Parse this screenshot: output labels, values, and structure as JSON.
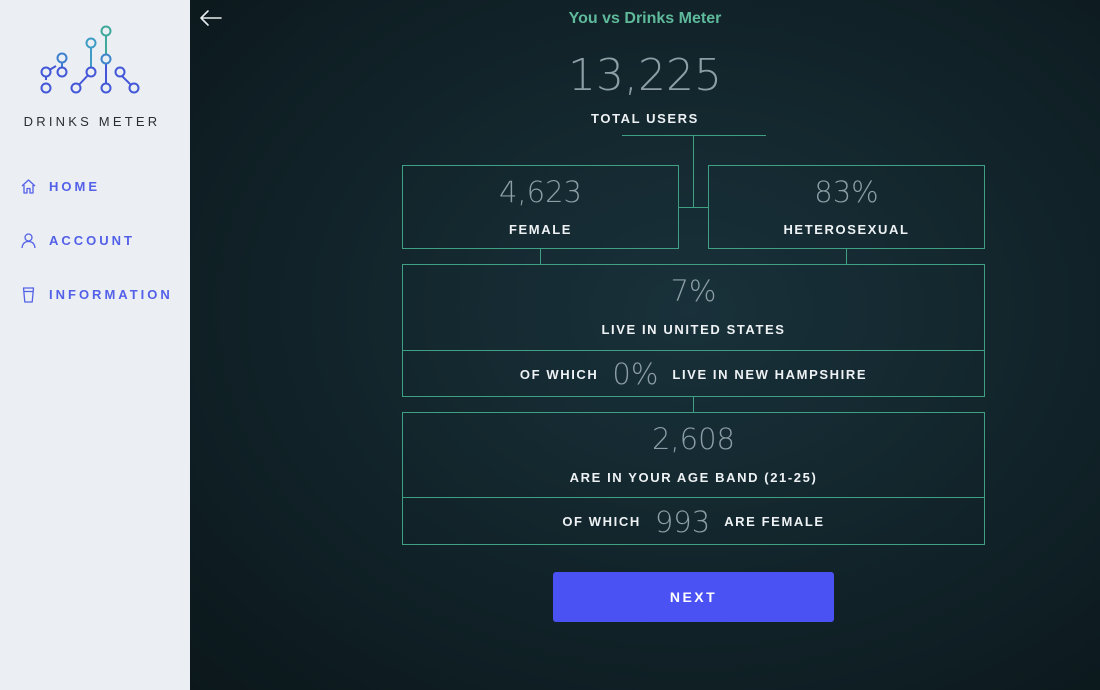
{
  "app": {
    "logo_text": "DRINKS METER"
  },
  "sidebar": {
    "items": [
      {
        "label": "HOME",
        "icon": "home-icon"
      },
      {
        "label": "ACCOUNT",
        "icon": "user-icon"
      },
      {
        "label": "INFORMATION",
        "icon": "cup-icon"
      }
    ]
  },
  "header": {
    "title": "You vs Drinks Meter",
    "back_icon": "arrow-left-icon"
  },
  "stats": {
    "total": {
      "value": "13,225",
      "label": "TOTAL USERS"
    },
    "female": {
      "value": "4,623",
      "label": "FEMALE"
    },
    "hetero": {
      "value": "83%",
      "label": "HETEROSEXUAL"
    },
    "country": {
      "value": "7%",
      "label": "LIVE IN UNITED STATES"
    },
    "state": {
      "prefix": "OF WHICH",
      "value": "0%",
      "suffix": "LIVE IN NEW HAMPSHIRE"
    },
    "age": {
      "value": "2,608",
      "label": "ARE IN YOUR AGE BAND (21-25)"
    },
    "age_female": {
      "prefix": "OF WHICH",
      "value": "993",
      "suffix": "ARE FEMALE"
    }
  },
  "actions": {
    "next_label": "NEXT"
  },
  "colors": {
    "accent": "#4a52f4",
    "line": "#3fa083",
    "title": "#5fba9b",
    "sidebar_bg": "#ebeff3",
    "nav_text": "#5360e8"
  }
}
